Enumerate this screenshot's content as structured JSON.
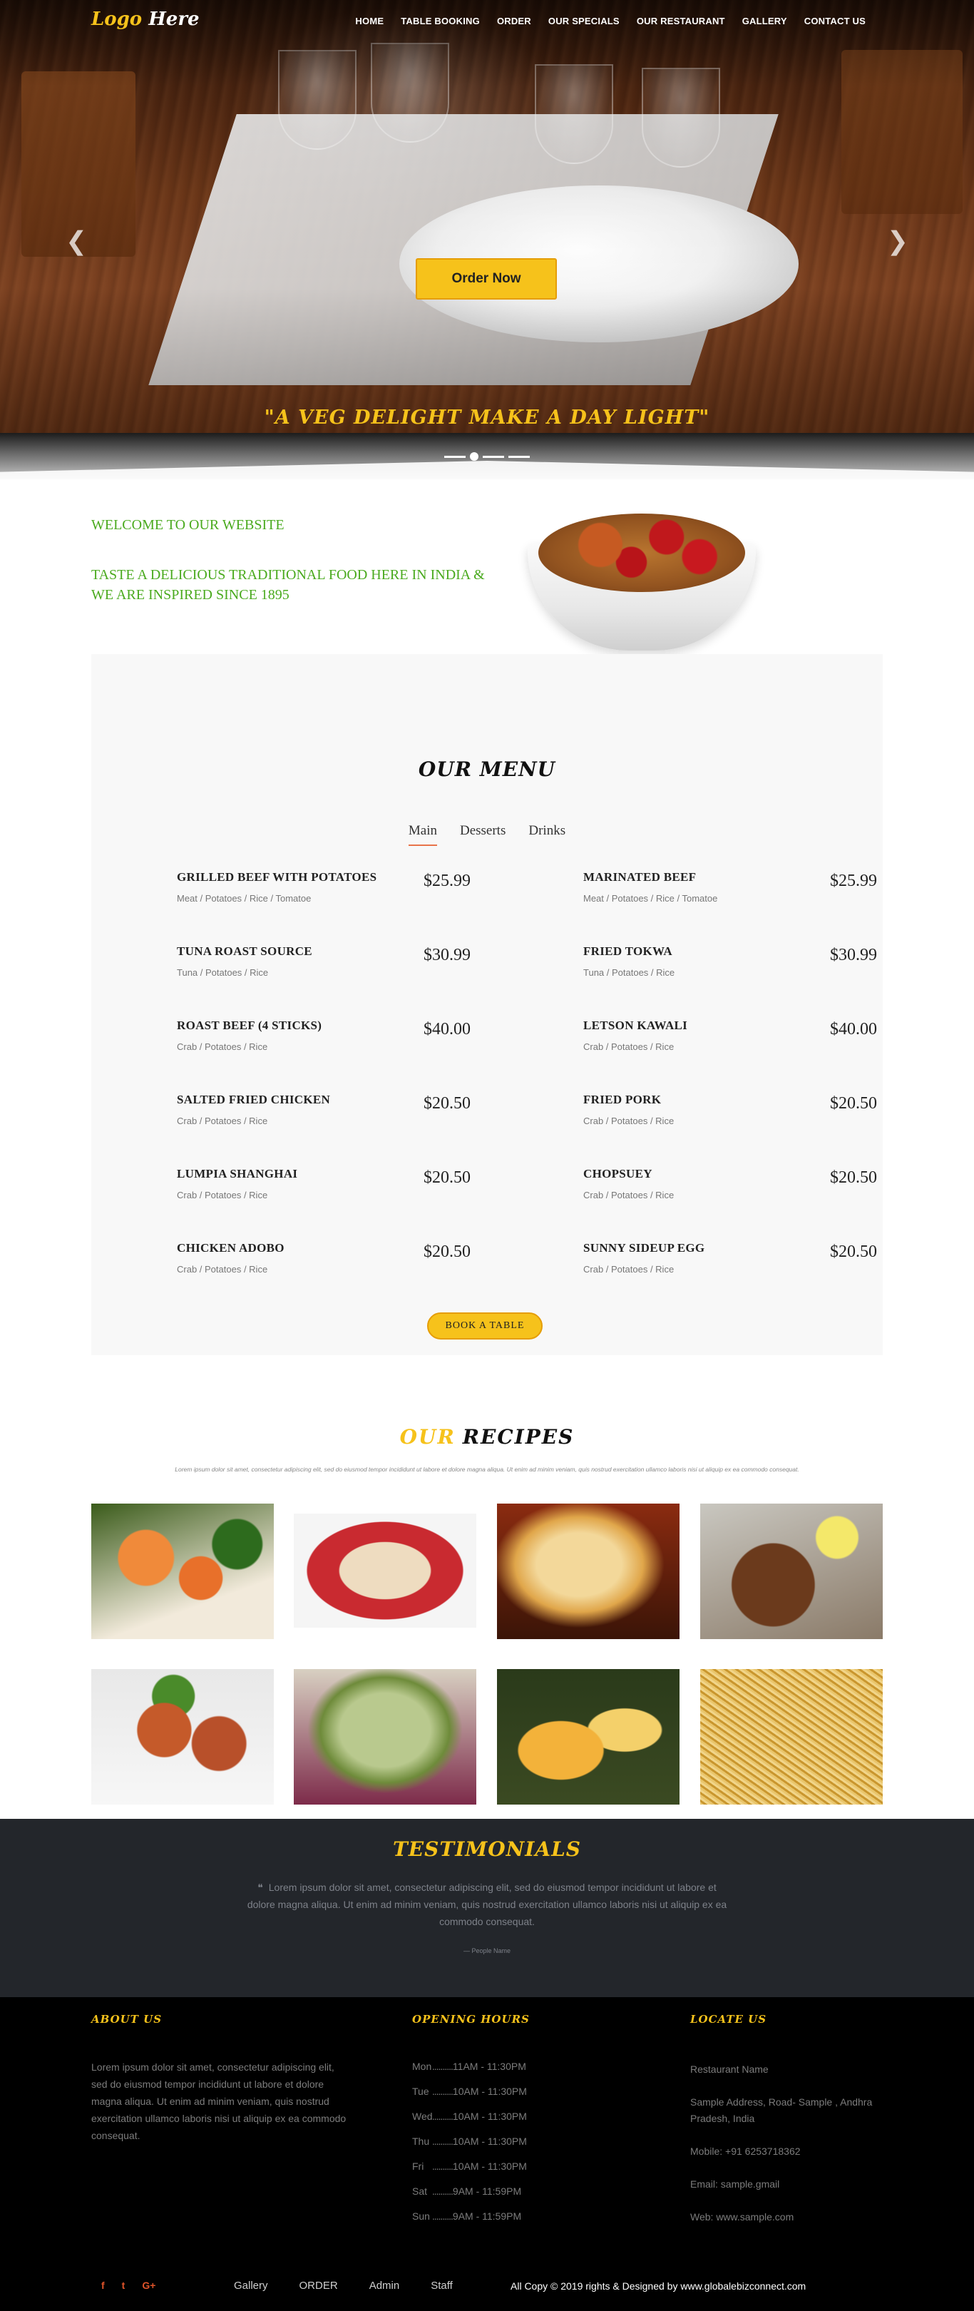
{
  "header": {
    "logo_part1": "Logo",
    "logo_part2": "Here",
    "nav": [
      "HOME",
      "TABLE BOOKING",
      "ORDER",
      "OUR SPECIALS",
      "OUR RESTAURANT",
      "GALLERY",
      "CONTACT US"
    ]
  },
  "hero": {
    "order_button": "Order Now",
    "tagline": "\"A VEG DELIGHT MAKE A DAY LIGHT\"",
    "prev_icon": "chevron-left-icon",
    "next_icon": "chevron-right-icon"
  },
  "welcome": {
    "line1": "WELCOME TO OUR WEBSITE",
    "line2": "TASTE A DELICIOUS TRADITIONAL FOOD HERE IN INDIA & WE ARE INSPIRED SINCE 1895"
  },
  "menu": {
    "title": "OUR MENU",
    "tabs": [
      "Main",
      "Desserts",
      "Drinks"
    ],
    "left": [
      {
        "name": "GRILLED BEEF WITH POTATOES",
        "ingredients": "Meat / Potatoes / Rice / Tomatoe",
        "price": "$25.99"
      },
      {
        "name": "TUNA ROAST SOURCE",
        "ingredients": "Tuna / Potatoes / Rice",
        "price": "$30.99"
      },
      {
        "name": "ROAST BEEF (4 STICKS)",
        "ingredients": "Crab / Potatoes / Rice",
        "price": "$40.00"
      },
      {
        "name": "SALTED FRIED CHICKEN",
        "ingredients": "Crab / Potatoes / Rice",
        "price": "$20.50"
      },
      {
        "name": "LUMPIA SHANGHAI",
        "ingredients": "Crab / Potatoes / Rice",
        "price": "$20.50"
      },
      {
        "name": "CHICKEN ADOBO",
        "ingredients": "Crab / Potatoes / Rice",
        "price": "$20.50"
      }
    ],
    "right": [
      {
        "name": "MARINATED BEEF",
        "ingredients": "Meat / Potatoes / Rice / Tomatoe",
        "price": "$25.99"
      },
      {
        "name": "FRIED TOKWA",
        "ingredients": "Tuna / Potatoes / Rice",
        "price": "$30.99"
      },
      {
        "name": "LETSON KAWALI",
        "ingredients": "Crab / Potatoes / Rice",
        "price": "$40.00"
      },
      {
        "name": "FRIED PORK",
        "ingredients": "Crab / Potatoes / Rice",
        "price": "$20.50"
      },
      {
        "name": "CHOPSUEY",
        "ingredients": "Crab / Potatoes / Rice",
        "price": "$20.50"
      },
      {
        "name": "SUNNY SIDEUP EGG",
        "ingredients": "Crab / Potatoes / Rice",
        "price": "$20.50"
      }
    ],
    "book_button": "BOOK A TABLE"
  },
  "recipes": {
    "title_part1": "OUR",
    "title_part2": "RECIPES",
    "subtitle": "Lorem ipsum dolor sit amet, consectetur adipiscing elit, sed do eiusmod tempor incididunt ut labore et dolore magna aliqua. Ut enim ad minim veniam, quis nostrud exercitation ullamco laboris nisi ut aliquip ex ea commodo consequat."
  },
  "testimonials": {
    "title": "TESTIMONIALS",
    "quote_icon": "quote-icon",
    "quote": "Lorem ipsum dolor sit amet, consectetur adipiscing elit, sed do eiusmod tempor incididunt ut labore et dolore magna aliqua. Ut enim ad minim veniam, quis nostrud exercitation ullamco laboris nisi ut aliquip ex ea commodo consequat.",
    "author": "— People Name"
  },
  "footer": {
    "about_title": "ABOUT US",
    "about_text": "Lorem ipsum dolor sit amet, consectetur adipiscing elit, sed do eiusmod tempor incididunt ut labore et dolore magna aliqua. Ut enim ad minim veniam, quis nostrud exercitation ullamco laboris nisi ut aliquip ex ea commodo consequat.",
    "hours_title": "OPENING HOURS",
    "hours": [
      {
        "day": "Mon",
        "time": "11AM - 11:30PM"
      },
      {
        "day": "Tue",
        "time": "10AM - 11:30PM"
      },
      {
        "day": "Wed",
        "time": "10AM - 11:30PM"
      },
      {
        "day": "Thu",
        "time": "10AM - 11:30PM"
      },
      {
        "day": "Fri",
        "time": "10AM - 11:30PM"
      },
      {
        "day": "Sat",
        "time": "9AM - 11:59PM"
      },
      {
        "day": "Sun",
        "time": "9AM - 11:59PM"
      }
    ],
    "locate_title": "LOCATE US",
    "restaurant_name": "Restaurant Name",
    "address": "Sample Address, Road- Sample , Andhra Pradesh, India",
    "mobile": "Mobile: +91 6253718362",
    "email": "Email: sample.gmail",
    "web": "Web: www.sample.com",
    "social": [
      "f",
      "t",
      "G+"
    ],
    "links": [
      "Gallery",
      "ORDER",
      "Admin",
      "Staff"
    ],
    "copyright": "All Copy © 2019 rights & Designed by",
    "copyright_site": "www.globalebizconnect.com"
  },
  "colors": {
    "accent": "#f6c21b",
    "green": "#4aaa1e",
    "dark": "#23262b"
  }
}
